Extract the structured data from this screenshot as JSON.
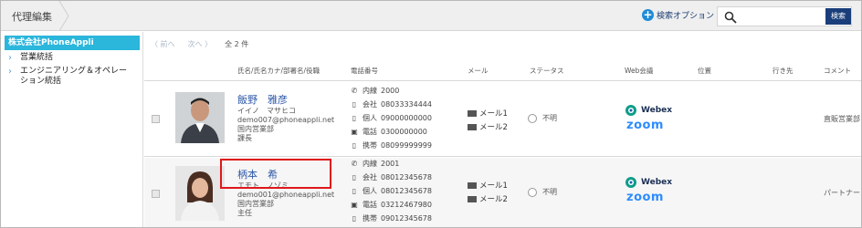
{
  "header": {
    "breadcrumb": "代理編集",
    "search_option_label": "検索オプション",
    "search_placeholder": "",
    "search_button_label": "検索"
  },
  "sidebar": {
    "root": "株式会社PhoneAppli",
    "items": [
      {
        "label": "営業統括"
      },
      {
        "label": "エンジニアリング＆オペレー"
      },
      {
        "label": "ション統括"
      }
    ]
  },
  "pager": {
    "prev": "〈 前へ",
    "next": "次へ 〉",
    "count": "全 2 件"
  },
  "columns": {
    "name": "氏名/氏名カナ/部署名/役職",
    "phone": "電話番号",
    "mail": "メール",
    "status": "ステータス",
    "web": "Web会議",
    "location": "位置",
    "destination": "行き先",
    "comment": "コメント"
  },
  "rows": [
    {
      "name": "飯野　雅彦",
      "kana": "イイノ　マサヒコ",
      "email": "demo007@phoneappli.net",
      "dept": "国内営業部",
      "title": "課長",
      "phones": [
        {
          "icon": "phone-handset-icon",
          "label": "内線",
          "value": "2000"
        },
        {
          "icon": "mobile-icon",
          "label": "会社",
          "value": "08033334444"
        },
        {
          "icon": "mobile-icon",
          "label": "個人",
          "value": "09000000000"
        },
        {
          "icon": "fax-icon",
          "label": "電話",
          "value": "0300000000"
        },
        {
          "icon": "mobile-icon",
          "label": "携帯",
          "value": "08099999999"
        }
      ],
      "mail1": "メール1",
      "mail2": "メール2",
      "status": "不明",
      "webex": "Webex",
      "zoom": "zoom",
      "comment": "直販営業部"
    },
    {
      "name": "柄本　希",
      "kana": "エモト　ノゾミ",
      "email": "demo001@phoneappli.net",
      "dept": "国内営業部",
      "title": "主任",
      "phones": [
        {
          "icon": "phone-handset-icon",
          "label": "内線",
          "value": "2001"
        },
        {
          "icon": "mobile-icon",
          "label": "会社",
          "value": "08012345678"
        },
        {
          "icon": "mobile-icon",
          "label": "個人",
          "value": "08012345678"
        },
        {
          "icon": "fax-icon",
          "label": "電話",
          "value": "03212467980"
        },
        {
          "icon": "mobile-icon",
          "label": "携帯",
          "value": "09012345678"
        }
      ],
      "mail1": "メール1",
      "mail2": "メール2",
      "status": "不明",
      "webex": "Webex",
      "zoom": "zoom",
      "comment": "パートナー"
    }
  ]
}
